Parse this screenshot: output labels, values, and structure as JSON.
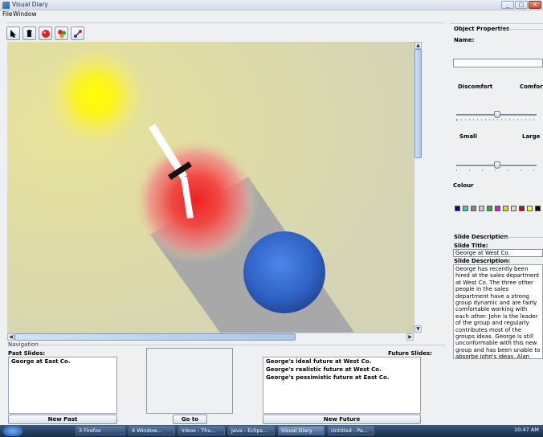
{
  "window": {
    "title": "Visual Diary",
    "min_label": "_",
    "max_label": "□",
    "close_label": "✕"
  },
  "menubar": {
    "items": [
      "File",
      "Window"
    ]
  },
  "toolbar": {
    "tools": [
      "select-tool",
      "delete-tool",
      "add-object-tool",
      "add-group-tool",
      "connect-tool"
    ]
  },
  "navigation": {
    "title": "Navigation",
    "past_label": "Past Slides:",
    "past_items": [
      "George at East Co."
    ],
    "future_label": "Future Slides:",
    "future_items": [
      "George's ideal future at West Co.",
      "George's realistic future at West Co.",
      "George's pessimistic future at East Co."
    ],
    "new_past": "New Past",
    "go_to_slide": "Go to Slide",
    "new_future": "New Future"
  },
  "properties": {
    "title": "Object Properties",
    "name_label": "Name:",
    "name_value": "",
    "discomfort": "Discomfort",
    "comfort": "Comfort",
    "comfort_level": 0.5,
    "small": "Small",
    "large": "Large",
    "size_level": 0.5,
    "colour_label": "Colour",
    "colours": [
      "#0000cc",
      "#33cccc",
      "#888888",
      "#cccccc",
      "#00cc00",
      "#ff00ff",
      "#ffcc00",
      "#ffcccc",
      "#dd0000",
      "#ffff00",
      "#000000"
    ]
  },
  "slide": {
    "title": "Slide Description",
    "title_label": "Slide Title:",
    "title_value": "George at West Co.",
    "desc_label": "Slide Description:",
    "desc_value": "George has recently been hired at the sales department at West Co.  The three other people in the sales department have a strong group dynamic and are fairly comfortable working with each other.  John is the leader of the group and regularly contributes most of the groups ideas. George is still unconformable with this new group and has been unable to absorbe John's ideas.  Alan has been helping George by trying to explain those ideas in a way George can understand"
  },
  "taskbar": {
    "items": [
      "3 Firefox",
      "4 Window...",
      "Inbox - Thu...",
      "Java - Eclips...",
      "Visual Diary",
      "Untitled - Pa..."
    ],
    "clock": "10:47 AM"
  }
}
